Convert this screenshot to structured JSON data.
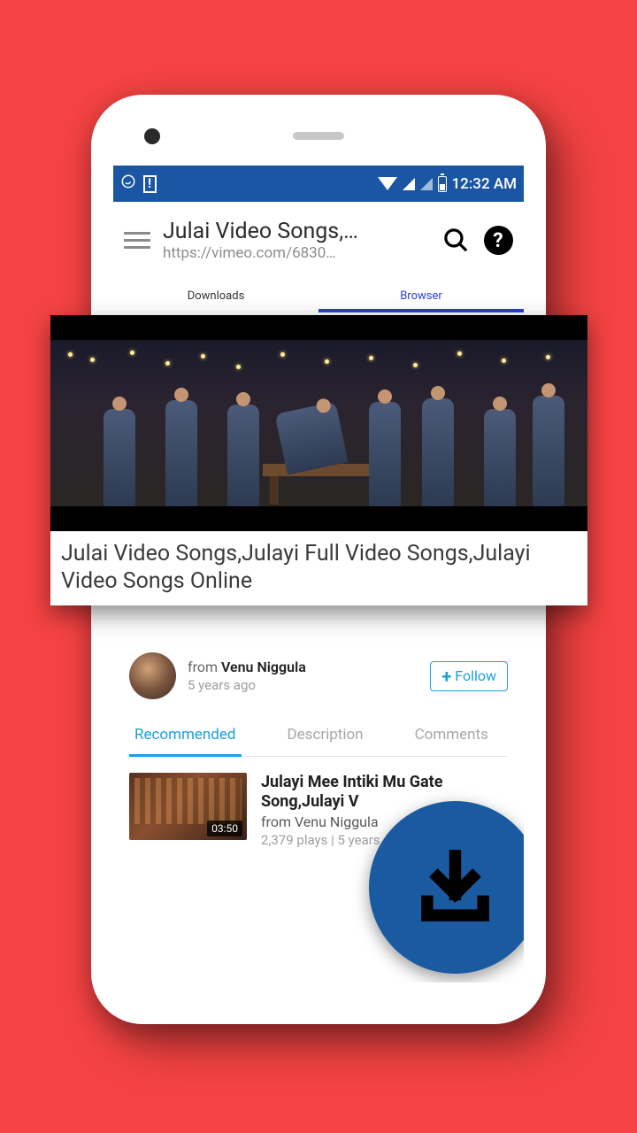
{
  "status": {
    "time": "12:32 AM"
  },
  "appbar": {
    "title": "Julai Video Songs,…",
    "url": "https://vimeo.com/6830…"
  },
  "tabs": {
    "downloads": "Downloads",
    "browser": "Browser"
  },
  "popout": {
    "title": "Julai Video Songs,Julayi Full Video Songs,Julayi Video Songs Online"
  },
  "author": {
    "from_label": "from ",
    "name": "Venu Niggula",
    "age": "5 years ago"
  },
  "follow": {
    "label": "Follow"
  },
  "subtabs": {
    "recommended": "Recommended",
    "description": "Description",
    "comments": "Comments"
  },
  "rec": {
    "title": "Julayi Mee Intiki Mu Gate Song,Julayi V",
    "from": "from Venu Niggula",
    "meta": "2,379 plays | 5 years ago",
    "duration": "03:50"
  },
  "colors": {
    "accent_blue": "#1aa0de",
    "tab_blue": "#2a3fd4",
    "fab_blue": "#195aa0",
    "status_blue": "#1a56a3",
    "bg_red": "#f54343"
  }
}
